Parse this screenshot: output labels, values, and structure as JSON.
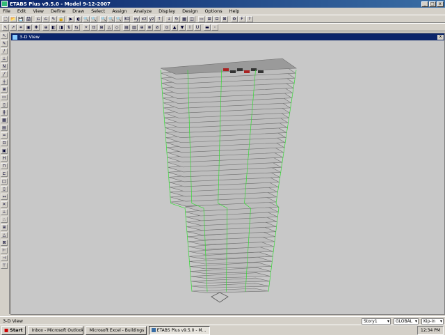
{
  "window": {
    "title": "ETABS Plus v9.5.0 - Model 9-12-2007",
    "min": "_",
    "max": "□",
    "close": "x"
  },
  "menu": [
    "File",
    "Edit",
    "View",
    "Define",
    "Draw",
    "Select",
    "Assign",
    "Analyze",
    "Display",
    "Design",
    "Options",
    "Help"
  ],
  "toolbar1": [
    "🗋",
    "📂",
    "💾",
    "🖨",
    "⎌",
    "⎌",
    "✎",
    "🔒",
    "▶",
    "◐",
    "🔍",
    "🔍",
    "🔍",
    "🔍",
    "🔍",
    "3D",
    "xy",
    "xz",
    "yz",
    "↑",
    "↓",
    "↻",
    "▦",
    "◫",
    "▭",
    "⊞",
    "⊟",
    "⊠",
    "⚙",
    "F",
    "?"
  ],
  "toolbar2": [
    "↖",
    "↗",
    "⌗",
    "▣",
    "✚",
    "⊕",
    "◧",
    "◨",
    "⇅",
    "⇆",
    "⌖",
    "⊡",
    "⊞",
    "△",
    "◇",
    "▤",
    "▥",
    "⊕",
    "⊗",
    "⊘",
    "⊙",
    "▲",
    "▼",
    "I",
    "U",
    "▬",
    "◦"
  ],
  "lefttools": [
    "↖",
    "✎",
    "/",
    "⊥",
    "N",
    "╱",
    "┼",
    "⊞",
    "▭",
    "▯",
    "╫",
    "▦",
    "▤",
    "═",
    "⊡",
    "▣",
    "H",
    "⊓",
    "⊏",
    "□",
    "▯",
    "↔",
    "✕",
    "⊥",
    "∴",
    "⊞",
    "△",
    "⊠",
    "⊢",
    "⊣",
    "⊤"
  ],
  "view": {
    "title": "3-D View",
    "close": "x"
  },
  "status": {
    "text": "3-D View",
    "story": "Story1",
    "coords": "GLOBAL",
    "units": "Kip-in"
  },
  "taskbar": {
    "start": "Start",
    "items": [
      {
        "label": "Inbox - Microsoft Outlook",
        "active": false
      },
      {
        "label": "Microsoft Excel - Buildings",
        "active": false
      },
      {
        "label": "ETABS Plus v9.5.0 - M...",
        "active": true
      }
    ],
    "clock": "12:34 PM"
  },
  "colors": {
    "titlebar": "#0a246a",
    "viewport": "#c8c8c8",
    "frame_lines": "#33dd33",
    "slab_edge": "#707070",
    "slab_fill": "#bdbdbd"
  }
}
